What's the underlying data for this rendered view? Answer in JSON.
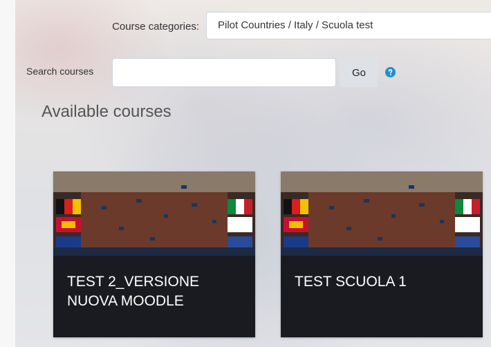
{
  "filters": {
    "categories_label": "Course categories:",
    "categories_value": "Pilot Countries / Italy / Scuola test"
  },
  "search": {
    "label": "Search courses",
    "value": "",
    "go_label": "Go",
    "help_icon": "question-circle-icon",
    "help_color": "#1f8fcf"
  },
  "heading": "Available courses",
  "courses": [
    {
      "title": "TEST 2_VERSIONE NUOVA MOODLE"
    },
    {
      "title": "TEST SCUOLA 1"
    }
  ]
}
